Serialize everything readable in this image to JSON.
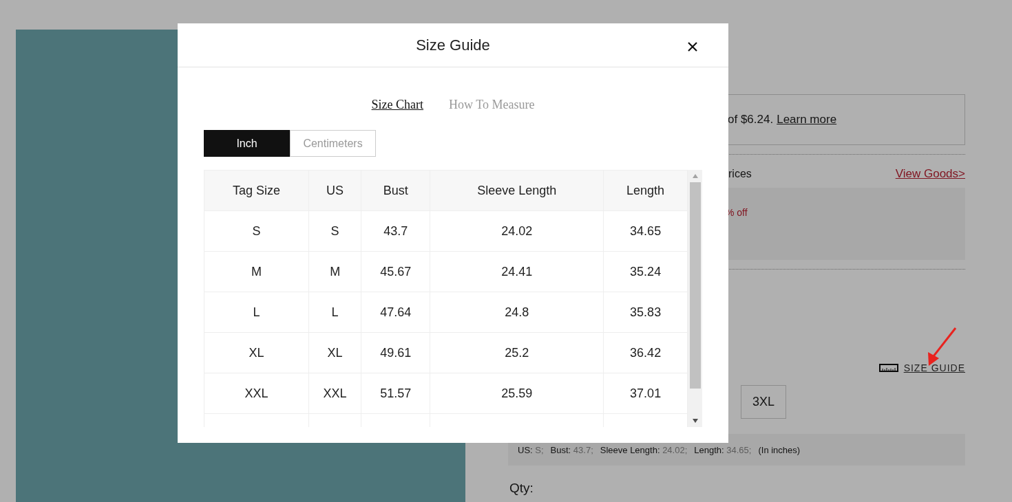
{
  "page": {
    "price_note": "of $6.24.",
    "learn_more": "Learn more",
    "bundle_label": "rices",
    "view_goods": "View Goods>",
    "discount": "% off",
    "size_guide_link": "SIZE GUIDE",
    "sizes": [
      {
        "label": "3XL",
        "selected": false
      }
    ],
    "selection_summary": [
      {
        "label": "US:",
        "value": "S;"
      },
      {
        "label": "Bust:",
        "value": "43.7;"
      },
      {
        "label": "Sleeve Length:",
        "value": "24.02;"
      },
      {
        "label": "Length:",
        "value": "34.65;"
      }
    ],
    "summary_unit": "(In inches)",
    "qty_label": "Qty:"
  },
  "modal": {
    "title": "Size Guide",
    "tabs": [
      {
        "label": "Size Chart",
        "selected": true
      },
      {
        "label": "How To Measure",
        "selected": false
      }
    ],
    "units": [
      {
        "label": "Inch",
        "selected": true
      },
      {
        "label": "Centimeters",
        "selected": false
      }
    ],
    "table": {
      "columns": [
        "Tag Size",
        "US",
        "Bust",
        "Sleeve Length",
        "Length"
      ],
      "rows": [
        [
          "S",
          "S",
          "43.7",
          "24.02",
          "34.65"
        ],
        [
          "M",
          "M",
          "45.67",
          "24.41",
          "35.24"
        ],
        [
          "L",
          "L",
          "47.64",
          "24.8",
          "35.83"
        ],
        [
          "XL",
          "XL",
          "49.61",
          "25.2",
          "36.42"
        ],
        [
          "XXL",
          "XXL",
          "51.57",
          "25.59",
          "37.01"
        ]
      ]
    }
  }
}
